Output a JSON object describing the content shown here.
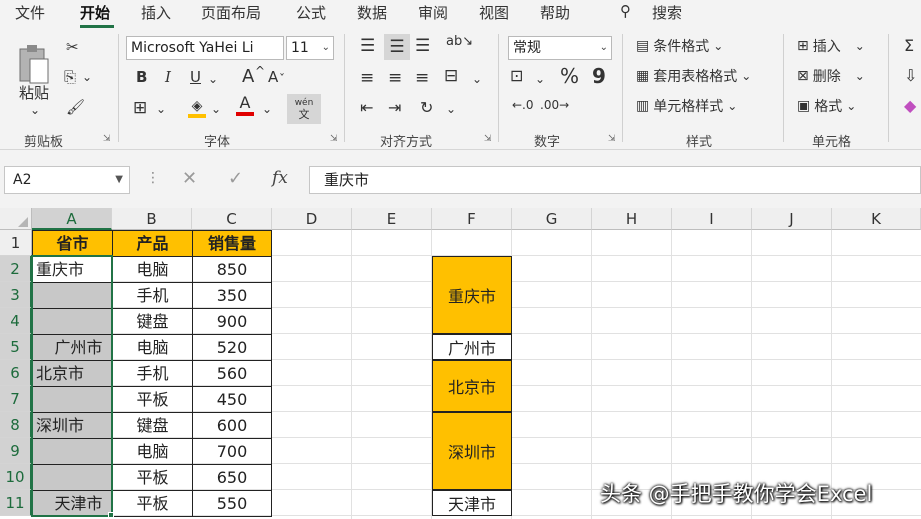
{
  "menu": {
    "tabs": [
      "文件",
      "开始",
      "插入",
      "页面布局",
      "公式",
      "数据",
      "审阅",
      "视图",
      "帮助"
    ],
    "search_label": "搜索"
  },
  "ribbon": {
    "clipboard": {
      "paste_label": "粘贴",
      "group_label": "剪贴板"
    },
    "font": {
      "font_name": "Microsoft YaHei Li",
      "font_size": "11",
      "bold": "B",
      "italic": "I",
      "underline": "U",
      "grow": "A",
      "shrink": "A",
      "phonetic_top": "wén",
      "phonetic_bottom": "文",
      "group_label": "字体"
    },
    "alignment": {
      "group_label": "对齐方式"
    },
    "number": {
      "format": "常规",
      "percent": "%",
      "comma": "9",
      "group_label": "数字"
    },
    "styles": {
      "conditional": "条件格式",
      "table": "套用表格格式",
      "cell_styles": "单元格样式",
      "group_label": "样式"
    },
    "cells": {
      "insert": "插入",
      "delete": "删除",
      "format": "格式",
      "group_label": "单元格"
    }
  },
  "formula_bar": {
    "name_box": "A2",
    "fx": "fx",
    "value": "重庆市"
  },
  "columns": [
    "A",
    "B",
    "C",
    "D",
    "E",
    "F",
    "G",
    "H",
    "I",
    "J",
    "K"
  ],
  "rows": [
    "1",
    "2",
    "3",
    "4",
    "5",
    "6",
    "7",
    "8",
    "9",
    "10",
    "11"
  ],
  "table": {
    "headers": [
      "省市",
      "产品",
      "销售量"
    ],
    "province": [
      "重庆市",
      "",
      "",
      "广州市",
      "北京市",
      "",
      "深圳市",
      "",
      "",
      "天津市"
    ],
    "product": [
      "电脑",
      "手机",
      "键盘",
      "电脑",
      "手机",
      "平板",
      "键盘",
      "电脑",
      "平板",
      "平板"
    ],
    "sales": [
      "850",
      "350",
      "900",
      "520",
      "560",
      "450",
      "600",
      "700",
      "650",
      "550"
    ]
  },
  "merged_f": [
    "重庆市",
    "广州市",
    "北京市",
    "深圳市",
    "天津市"
  ],
  "colors": {
    "accent": "#217346",
    "header_fill": "#ffc000",
    "selected_fill": "#c8c8c8"
  },
  "watermark": "头条 @手把手教你学会Excel"
}
